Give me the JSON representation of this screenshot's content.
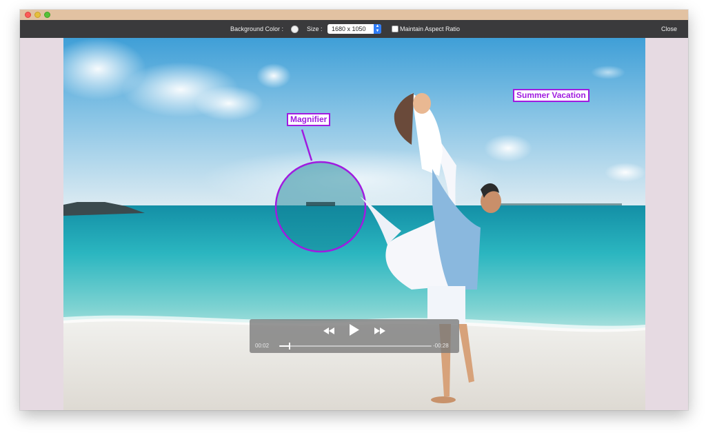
{
  "toolbar": {
    "background_color_label": "Background Color :",
    "background_color_value": "#f2f2f2",
    "size_label": "Size :",
    "size_value": "1680 x 1050",
    "maintain_aspect_label": "Maintain Aspect Ratio",
    "maintain_aspect_checked": false,
    "close_label": "Close"
  },
  "annotations": {
    "magnifier_label": "Magnifier",
    "summer_vacation_label": "Summer Vacation",
    "accent_color": "#a01be0"
  },
  "player": {
    "rewind_icon": "rewind-icon",
    "play_icon": "play-icon",
    "forward_icon": "fast-forward-icon",
    "elapsed": "00:02",
    "remaining": "-00:28",
    "progress": 0.07
  }
}
